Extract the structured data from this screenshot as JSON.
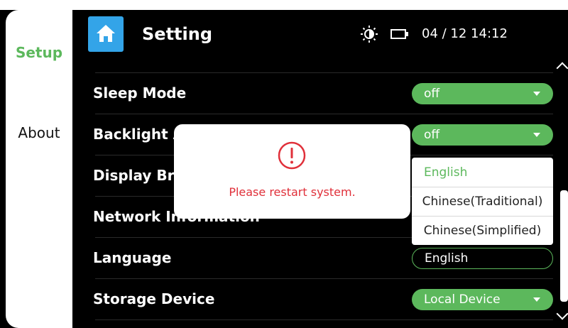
{
  "sidebar": {
    "items": [
      {
        "label": "Setup"
      },
      {
        "label": "About"
      }
    ]
  },
  "header": {
    "title": "Setting",
    "home_icon": "home-icon",
    "brightness_icon": "brightness-icon",
    "battery_icon": "battery-icon",
    "datetime": "04 / 12  14:12"
  },
  "settings": {
    "rows": [
      {
        "label": "Sleep Mode",
        "value": "off"
      },
      {
        "label": "Backlight A",
        "value": "off"
      },
      {
        "label": "Display Br"
      },
      {
        "label": "Network Information"
      },
      {
        "label": "Language",
        "value": "English"
      },
      {
        "label": "Storage Device",
        "value": "Local Device"
      }
    ]
  },
  "language_dropdown": {
    "options": [
      "English",
      "Chinese(Traditional)",
      "Chinese(Simplified)"
    ],
    "selected": "English"
  },
  "alert": {
    "icon": "exclamation-circle-icon",
    "message": "Please restart system."
  },
  "colors": {
    "accent": "#5cb85c",
    "home_button": "#33a4e8",
    "alert_text": "#e0303a",
    "background": "#000000"
  }
}
